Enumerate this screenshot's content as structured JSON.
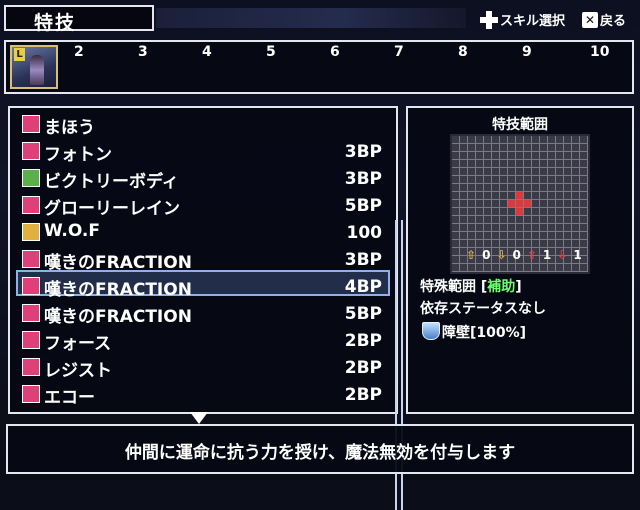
{
  "header": {
    "title": "特技",
    "hint_select": "スキル選択",
    "hint_back": "戻る"
  },
  "party": {
    "lead_level_badge": "L",
    "slots": [
      "2",
      "3",
      "4",
      "5",
      "6",
      "7",
      "8",
      "9",
      "10"
    ]
  },
  "skills": [
    {
      "name": "まほう",
      "cost": "",
      "icon": "magic-category-icon",
      "icon_color": "#e0407a"
    },
    {
      "name": "フォトン",
      "cost": "3BP",
      "icon": "attack-magic-icon",
      "icon_color": "#e0407a"
    },
    {
      "name": "ビクトリーボディ",
      "cost": "3BP",
      "icon": "support-magic-icon",
      "icon_color": "#5ab04a",
      "selected": true
    },
    {
      "name": "グローリーレイン",
      "cost": "5BP",
      "icon": "attack-magic-icon",
      "icon_color": "#e0407a"
    },
    {
      "name": "W.O.F",
      "cost": "100",
      "icon": "special-icon",
      "icon_color": "#e0b040"
    },
    {
      "name": "嘆きのFRACTION",
      "cost": "3BP",
      "icon": "music-icon",
      "icon_color": "#e0407a"
    },
    {
      "name": "嘆きのFRACTION",
      "cost": "4BP",
      "icon": "music-plus-icon",
      "icon_color": "#e0407a"
    },
    {
      "name": "嘆きのFRACTION",
      "cost": "5BP",
      "icon": "music-plus2-icon",
      "icon_color": "#e0407a"
    },
    {
      "name": "フォース",
      "cost": "2BP",
      "icon": "voice-icon",
      "icon_color": "#e0407a"
    },
    {
      "name": "レジスト",
      "cost": "2BP",
      "icon": "voice-icon",
      "icon_color": "#e0407a"
    },
    {
      "name": "エコー",
      "cost": "2BP",
      "icon": "voice-icon",
      "icon_color": "#e0407a"
    }
  ],
  "range_panel": {
    "title": "特技範囲",
    "stats": [
      "0",
      "0",
      "1",
      "1"
    ],
    "range_label": "特殊範囲",
    "range_type_open": "[",
    "range_type": "補助",
    "range_type_close": "]",
    "dependency": "依存ステータスなし",
    "effect": "障壁[100%]"
  },
  "description": "仲間に運命に抗う力を授け、魔法無効を付与します",
  "colors": {
    "accent_select": "#8fb0e8",
    "support_green": "#6cff6c",
    "target_red": "#e03838"
  }
}
